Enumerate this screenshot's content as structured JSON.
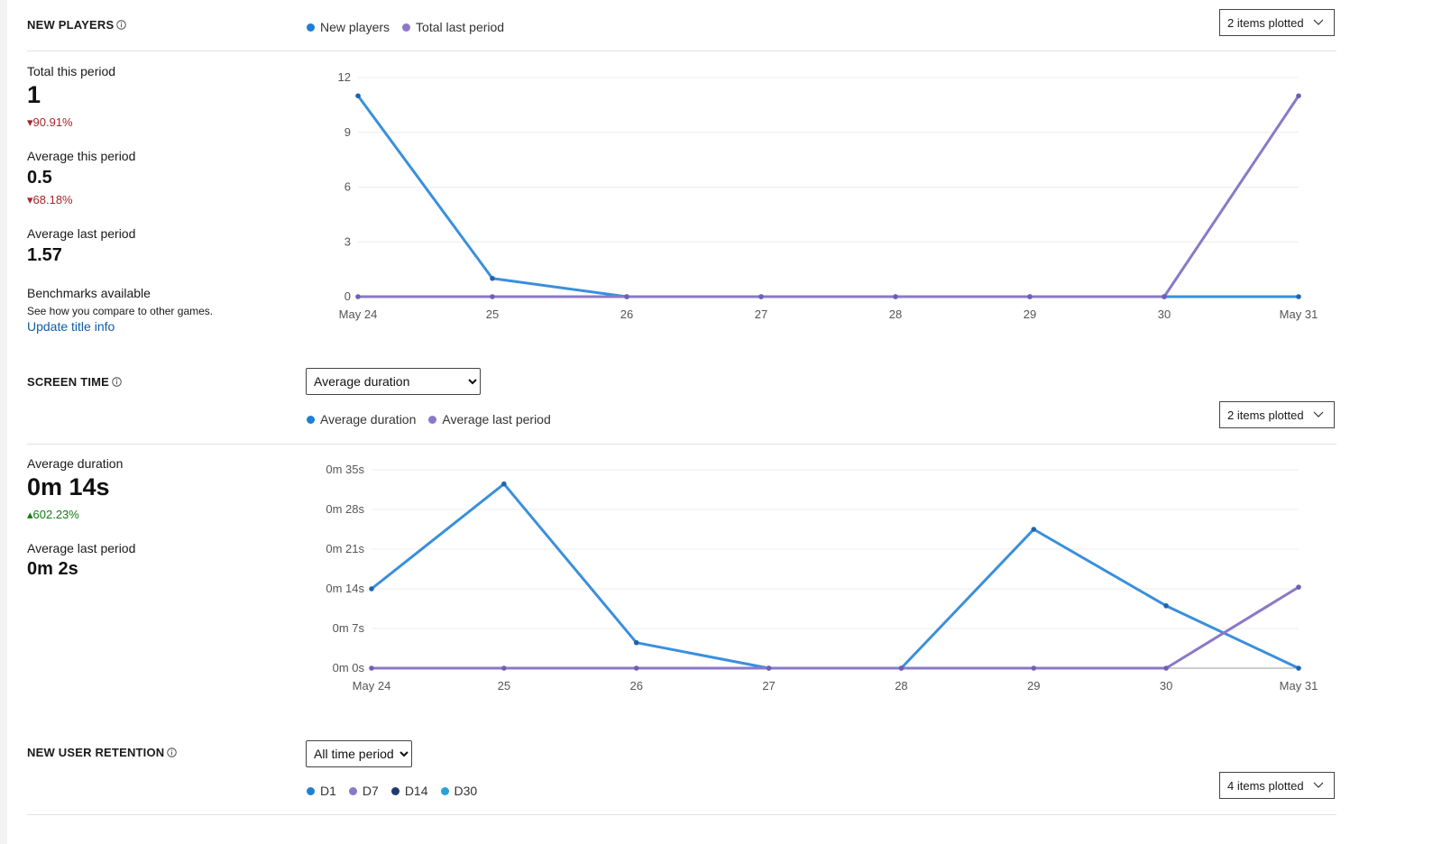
{
  "new_players": {
    "title": "NEW PLAYERS",
    "legend": [
      {
        "label": "New players",
        "color": "#1f7fd4"
      },
      {
        "label": "Total last period",
        "color": "#8a79c7"
      }
    ],
    "plot_button": "2 items plotted",
    "stats": {
      "total_label": "Total this period",
      "total_value": "1",
      "total_delta": "▾90.91%",
      "avg_label": "Average this period",
      "avg_value": "0.5",
      "avg_delta": "▾68.18%",
      "avg_last_label": "Average last period",
      "avg_last_value": "1.57"
    },
    "benchmarks": {
      "title": "Benchmarks available",
      "desc": "See how you compare to other games.",
      "link": "Update title info"
    },
    "chart_data": {
      "type": "line",
      "categories": [
        "May 24",
        "25",
        "26",
        "27",
        "28",
        "29",
        "30",
        "May 31"
      ],
      "y_ticks": [
        "0",
        "3",
        "6",
        "9",
        "12"
      ],
      "ylim": [
        0,
        12
      ],
      "grid": true,
      "series": [
        {
          "name": "New players",
          "color": "#3a8fdc",
          "values": [
            11,
            1,
            0,
            0,
            0,
            0,
            0,
            0
          ]
        },
        {
          "name": "Total last period",
          "color": "#8a79c7",
          "values": [
            0,
            0,
            0,
            0,
            0,
            0,
            0,
            11
          ]
        }
      ]
    }
  },
  "screen_time": {
    "title": "SCREEN TIME",
    "dropdown_value": "Average duration",
    "legend": [
      {
        "label": "Average duration",
        "color": "#1f7fd4"
      },
      {
        "label": "Average last period",
        "color": "#8a79c7"
      }
    ],
    "plot_button": "2 items plotted",
    "stats": {
      "avg_label": "Average duration",
      "avg_value": "0m 14s",
      "avg_delta": "▴602.23%",
      "avg_last_label": "Average last period",
      "avg_last_value": "0m 2s"
    },
    "chart_data": {
      "type": "line",
      "categories": [
        "May 24",
        "25",
        "26",
        "27",
        "28",
        "29",
        "30",
        "May 31"
      ],
      "y_ticks": [
        "0m 0s",
        "0m 7s",
        "0m 14s",
        "0m 21s",
        "0m 28s",
        "0m 35s"
      ],
      "ylim": [
        0,
        35
      ],
      "grid": true,
      "series": [
        {
          "name": "Average duration",
          "color": "#3a8fdc",
          "values": [
            14,
            32.5,
            4.5,
            0,
            0,
            24.5,
            11,
            0
          ]
        },
        {
          "name": "Average last period",
          "color": "#8a79c7",
          "values": [
            0,
            0,
            0,
            0,
            0,
            0,
            0,
            14.3
          ]
        }
      ]
    }
  },
  "retention": {
    "title": "NEW USER RETENTION",
    "dropdown_value": "All time periods",
    "legend": [
      {
        "label": "D1",
        "color": "#1f7fd4"
      },
      {
        "label": "D7",
        "color": "#8a79c7"
      },
      {
        "label": "D14",
        "color": "#1d3b6e"
      },
      {
        "label": "D30",
        "color": "#2aa0d8"
      }
    ],
    "plot_button": "4 items plotted"
  }
}
